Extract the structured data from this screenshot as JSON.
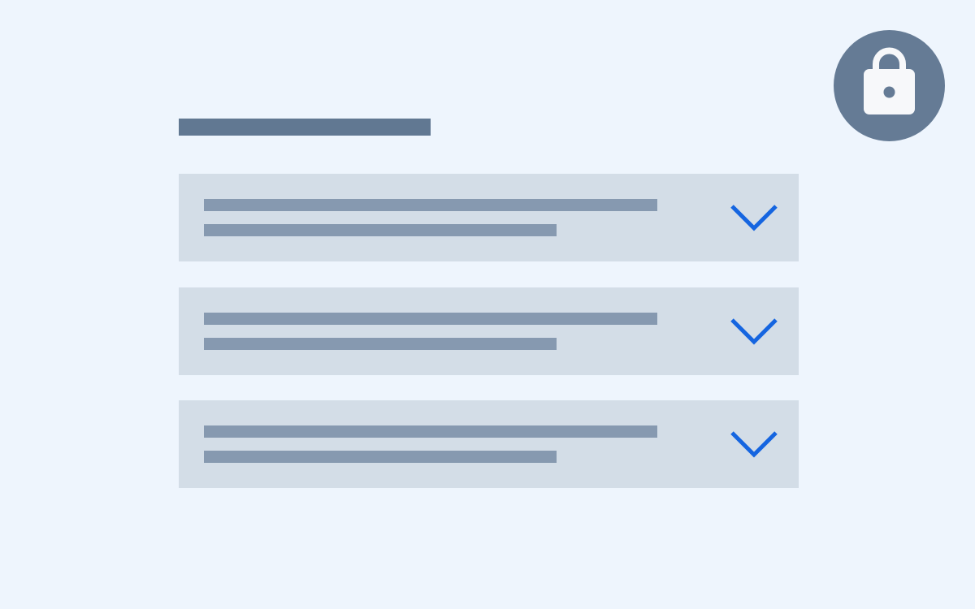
{
  "colors": {
    "background": "#EEF5FD",
    "title_placeholder": "#617892",
    "card_background": "#D3DDE7",
    "text_placeholder": "#8699B0",
    "chevron_accent": "#1565E0",
    "lock_badge": "#657B95",
    "lock_glyph": "#F7F8FA"
  },
  "header": {
    "title_icon": "title-placeholder"
  },
  "accordion": {
    "items": [
      {
        "state": "collapsed",
        "icon": "chevron-down-icon"
      },
      {
        "state": "collapsed",
        "icon": "chevron-down-icon"
      },
      {
        "state": "collapsed",
        "icon": "chevron-down-icon"
      }
    ]
  },
  "lock": {
    "icon": "lock-icon",
    "state": "locked"
  }
}
